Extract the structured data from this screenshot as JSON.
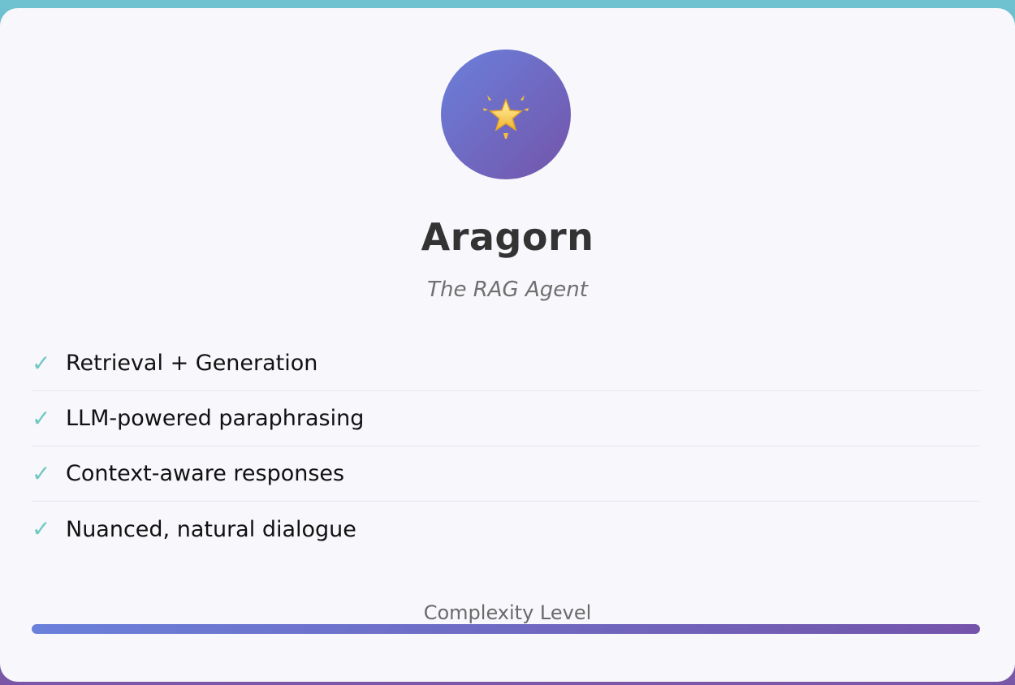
{
  "agent": {
    "name": "Aragorn",
    "role": "The RAG Agent",
    "avatar_icon": "glowing-star-icon",
    "accent_color": "#6fc8c3",
    "gradient_start": "#6a80db",
    "gradient_end": "#7454aa"
  },
  "features": [
    {
      "icon": "check-icon",
      "label": "Retrieval + Generation"
    },
    {
      "icon": "check-icon",
      "label": "LLM-powered paraphrasing"
    },
    {
      "icon": "check-icon",
      "label": "Context-aware responses"
    },
    {
      "icon": "check-icon",
      "label": "Nuanced, natural dialogue"
    }
  ],
  "complexity": {
    "label": "Complexity Level",
    "level_percent": 100
  }
}
